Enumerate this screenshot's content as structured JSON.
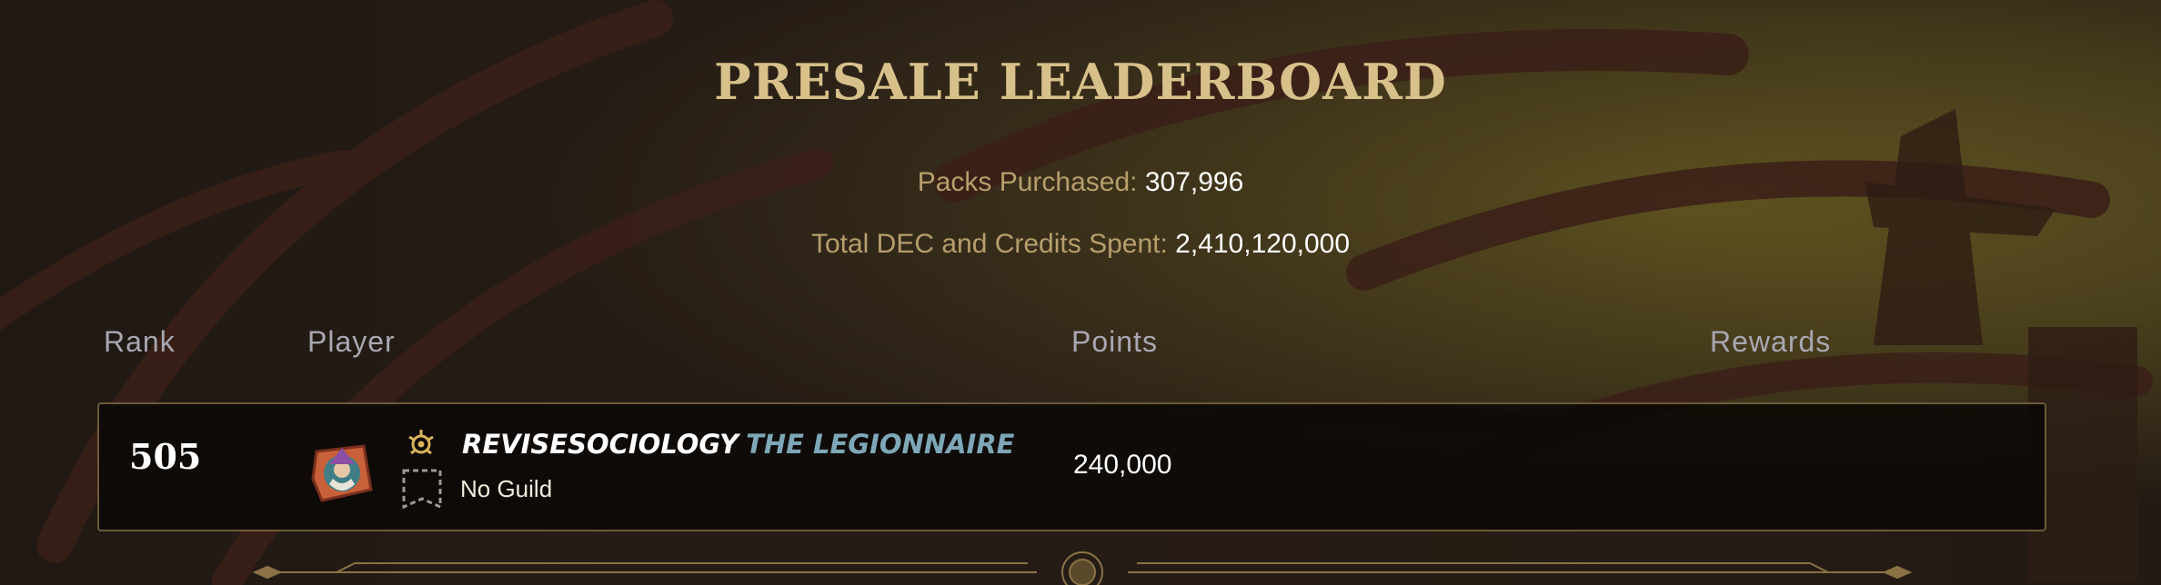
{
  "header": {
    "title": "PRESALE LEADERBOARD"
  },
  "stats": {
    "packs_label": "Packs Purchased:",
    "packs_value": "307,996",
    "spent_label": "Total DEC and Credits Spent:",
    "spent_value": "2,410,120,000"
  },
  "table": {
    "columns": {
      "rank": "Rank",
      "player": "Player",
      "points": "Points",
      "rewards": "Rewards"
    },
    "rows": [
      {
        "rank": "505",
        "player_name": "REVISESOCIOLOGY",
        "player_title": "THE LEGIONNAIRE",
        "guild": "No Guild",
        "points": "240,000",
        "rewards": "",
        "avatar_icon": "wizard-avatar-icon",
        "title_icon": "legionnaire-title-icon",
        "guild_icon": "no-guild-banner-icon"
      }
    ]
  },
  "colors": {
    "title_gold": "#d8c08a",
    "label_tan": "#b79e6c",
    "header_gray": "#a8a7b2",
    "title_blue": "#7ea7b8",
    "row_border": "#6d5a39"
  }
}
